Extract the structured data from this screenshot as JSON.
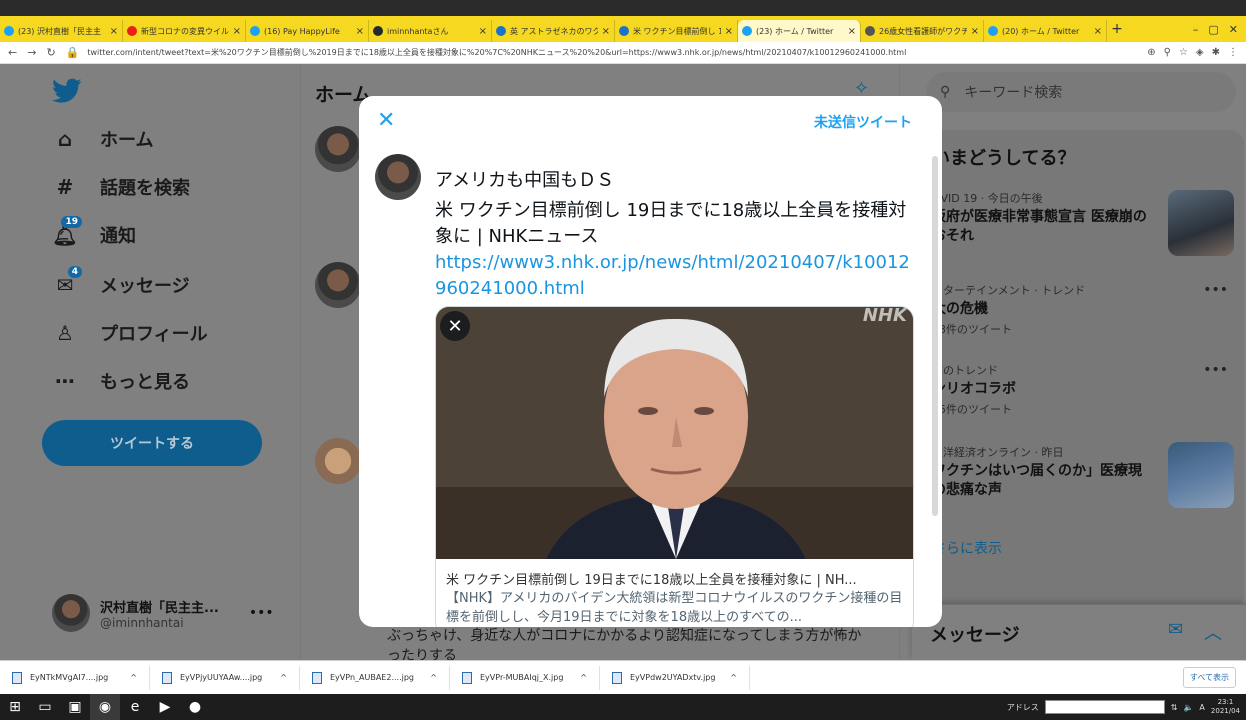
{
  "browser": {
    "tabs": [
      {
        "title": "(23) 沢村直樹「民主主",
        "favicon": "twitter"
      },
      {
        "title": "新型コロナの変異ウイルス",
        "favicon": "youtube"
      },
      {
        "title": "(16) Pay HappyLife",
        "favicon": "twitter"
      },
      {
        "title": "iminnhantaさん",
        "favicon": "github"
      },
      {
        "title": "英 アストラゼネカのワクチン",
        "favicon": "nhk"
      },
      {
        "title": "米 ワクチン目標前倒し 19",
        "favicon": "nhk"
      },
      {
        "title": "(23) ホーム / Twitter",
        "favicon": "twitter",
        "active": true
      },
      {
        "title": "26歳女性看護師がワクチ",
        "favicon": "other"
      },
      {
        "title": "(20) ホーム / Twitter",
        "favicon": "twitter"
      }
    ],
    "url": "twitter.com/intent/tweet?text=米%20ワクチン目標前倒し%2019日までに18歳以上全員を接種対象に%20%7C%20NHKニュース%20%20&url=https://www3.nhk.or.jp/news/html/20210407/k10012960241000.html"
  },
  "nav": {
    "items": [
      {
        "label": "ホーム",
        "icon": "home-icon"
      },
      {
        "label": "話題を検索",
        "icon": "hashtag-icon"
      },
      {
        "label": "通知",
        "icon": "bell-icon",
        "badge": "19"
      },
      {
        "label": "メッセージ",
        "icon": "mail-icon",
        "badge": "4"
      },
      {
        "label": "プロフィール",
        "icon": "user-icon"
      },
      {
        "label": "もっと見る",
        "icon": "more-circle-icon"
      }
    ],
    "tweet_button": "ツイートする",
    "account": {
      "name": "沢村直樹「民主主...",
      "handle": "@iminnhantai"
    }
  },
  "feed": {
    "title": "ホーム",
    "partial_text": "ぶっちゃけ、身近な人がコロナにかかるより認知症になってしまう方が怖かったりする"
  },
  "right": {
    "search_placeholder": "キーワード検索",
    "trends_title": "いまどうしてる？",
    "trends": [
      {
        "category": "OVID 19 · 今日の午後",
        "title": "阪府が医療非常事態宣言 医療崩のおそれ",
        "count": ""
      },
      {
        "category": "ンターテインメント · トレンド",
        "title": "大の危機",
        "count": "53件のツイート"
      },
      {
        "category": "本のトレンド",
        "title": "ンリオコラボ",
        "count": "45件のツイート"
      },
      {
        "category": "東洋経済オンライン · 昨日",
        "title": "ワクチンはいつ届くのか」医療現の悲痛な声",
        "count": ""
      }
    ],
    "show_more": "さらに表示",
    "messages_title": "メッセージ"
  },
  "modal": {
    "drafts_label": "未送信ツイート",
    "line1": "アメリカも中国もＤＳ",
    "line2": "米 ワクチン目標前倒し 19日までに18歳以上全員を接種対象に | NHKニュース",
    "link": "https://www3.nhk.or.jp/news/html/20210407/k10012960241000.html",
    "card_title": "米 ワクチン目標前倒し 19日までに18歳以上全員を接種対象に | NH...",
    "card_desc": "【NHK】アメリカのバイデン大統領は新型コロナウイルスのワクチン接種の目標を前倒しし、今月19日までに対象を18歳以上のすべての...",
    "card_watermark": "NHK"
  },
  "downloads": {
    "items": [
      "EyNTkMVgAI7....jpg",
      "EyVPjyUUYAAw....jpg",
      "EyVPn_AUBAE2....jpg",
      "EyVPr-MUBAIqj_X.jpg",
      "EyVPdw2UYADxtv.jpg"
    ],
    "show_all": "すべて表示"
  },
  "taskbar": {
    "address_label": "アドレス",
    "time": "23:1",
    "date": "2021/04"
  }
}
